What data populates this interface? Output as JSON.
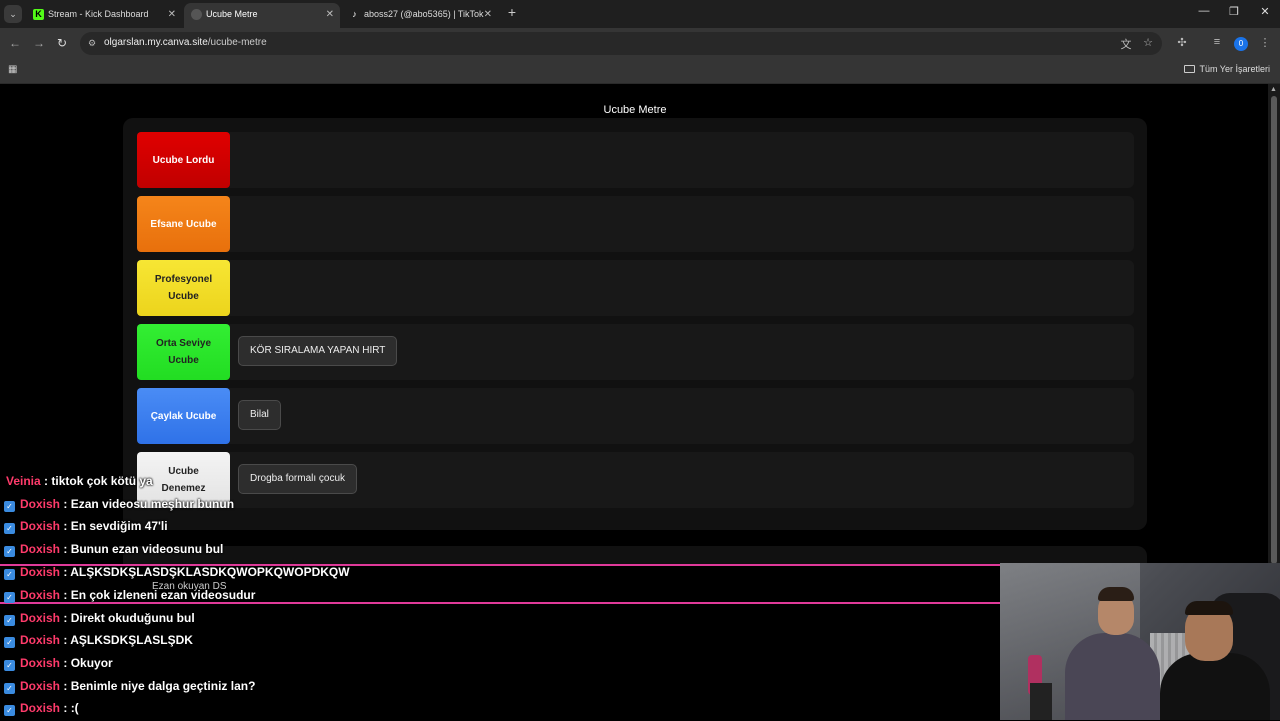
{
  "browser": {
    "tabs": [
      {
        "label": "Stream - Kick Dashboard",
        "icon": "kick-icon",
        "icon_color": "#53fc18",
        "active": false
      },
      {
        "label": "Ucube Metre",
        "icon": "canva-globe-icon",
        "icon_color": "#555555",
        "active": true
      },
      {
        "label": "aboss27 (@abo5365) | TikTok",
        "icon": "tiktok-icon",
        "icon_color": "#ffffff",
        "active": false
      }
    ],
    "url_host": "olgarslan.my.canva.site",
    "url_path": "/ucube-metre",
    "profile_initial": "0",
    "bookmarks_label": "Tüm Yer İşaretleri"
  },
  "page": {
    "title": "Ucube Metre",
    "tiers": [
      {
        "label": "Ucube Lordu",
        "bg": "#d90000",
        "text_color": "#ffffff",
        "items": []
      },
      {
        "label": "Efsane Ucube",
        "bg": "#f07a12",
        "text_color": "#ffffff",
        "items": []
      },
      {
        "label": "Profesyonel Ucube",
        "bg": "#f2e227",
        "text_color": "#222222",
        "items": []
      },
      {
        "label": "Orta Seviye Ucube",
        "bg": "#2be52b",
        "text_color": "#222222",
        "items": [
          "KÖR SIRALAMA YAPAN HIRT"
        ]
      },
      {
        "label": "Çaylak Ucube",
        "bg": "#3a80f0",
        "text_color": "#ffffff",
        "items": [
          "Bilal"
        ]
      },
      {
        "label": "Ucube Denemez",
        "bg": "#ececec",
        "text_color": "#222222",
        "items": [
          "Drogba formalı çocuk"
        ]
      }
    ]
  },
  "overlay": {
    "bar_text": "Ezan okuyan DS",
    "chat": [
      {
        "user": "Veinia",
        "message": "tiktok çok kötü ya",
        "badge": false
      },
      {
        "user": "Doxish",
        "message": "Ezan videosu meşhur bunun",
        "badge": true
      },
      {
        "user": "Doxish",
        "message": "En sevdiğim 47'li",
        "badge": true
      },
      {
        "user": "Doxish",
        "message": "Bunun ezan videosunu bul",
        "badge": true
      },
      {
        "user": "Doxish",
        "message": "ALŞKSDKŞLASDŞKLASDKQWOPKQWOPDKQW",
        "badge": true
      },
      {
        "user": "Doxish",
        "message": "En çok izleneni ezan videosudur",
        "badge": true
      },
      {
        "user": "Doxish",
        "message": "Direkt okuduğunu bul",
        "badge": true
      },
      {
        "user": "Doxish",
        "message": "AŞLKSDKŞLASLŞDK",
        "badge": true
      },
      {
        "user": "Doxish",
        "message": "Okuyor",
        "badge": true
      },
      {
        "user": "Doxish",
        "message": "Benimle niye dalga geçtiniz lan?",
        "badge": true
      },
      {
        "user": "Doxish",
        "message": ":(",
        "badge": true
      }
    ]
  }
}
